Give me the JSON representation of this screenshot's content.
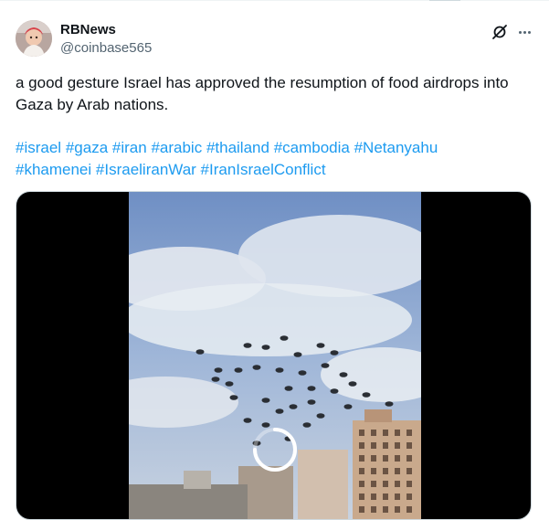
{
  "post": {
    "author_name": "RBNews",
    "author_handle": "@coinbase565",
    "text": "a good gesture Israel has approved the resumption of food airdrops into Gaza by Arab nations.",
    "hashtags_line1": [
      "#israel",
      "#gaza",
      "#iran",
      "#arabic",
      "#thailand",
      "#cambodia",
      "#Netanyahu"
    ],
    "hashtags_line2": [
      "#khamenei",
      "#IsraeliranWar",
      "#IranIsraelConflict"
    ]
  },
  "icons": {
    "grok": "grok-icon",
    "more": "more-icon",
    "spinner": "loading-spinner-icon"
  },
  "colors": {
    "link": "#1d9bf0",
    "text": "#0f1419",
    "secondary": "#536471"
  }
}
